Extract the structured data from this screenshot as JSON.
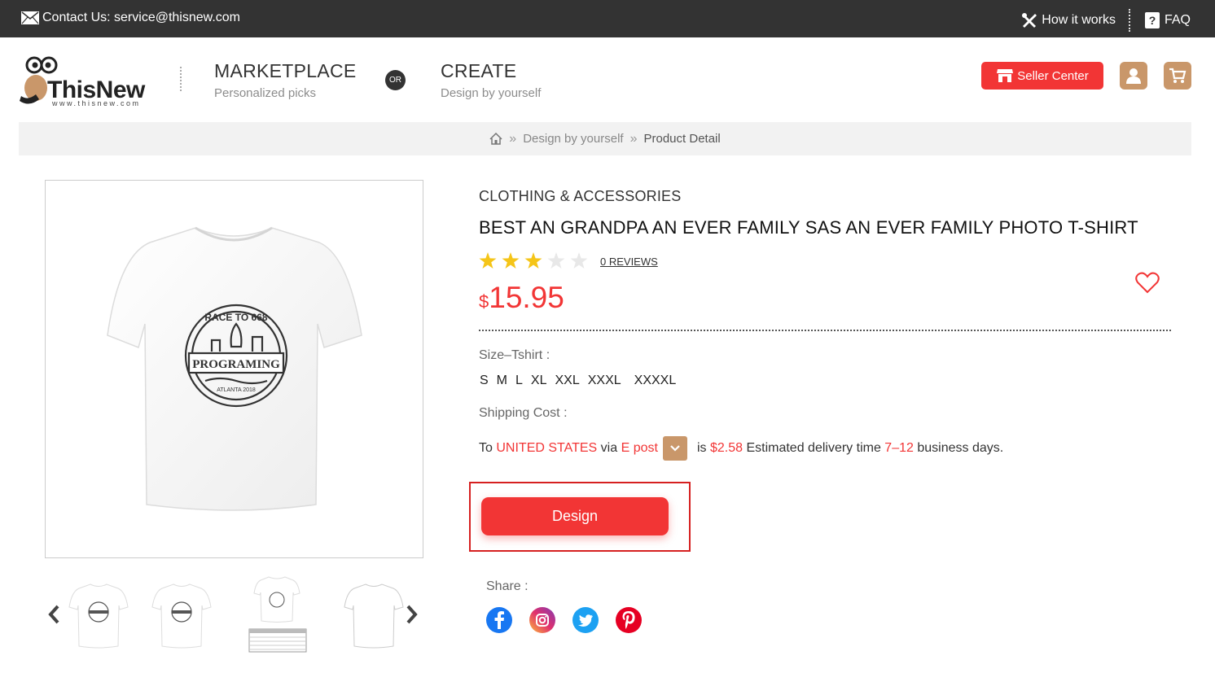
{
  "topbar": {
    "contact": "Contact Us: service@thisnew.com",
    "how_it_works": "How it works",
    "faq": "FAQ"
  },
  "header": {
    "logo_text": "ThisNew",
    "logo_url": "www.thisnew.com",
    "marketplace_title": "MARKETPLACE",
    "marketplace_sub": "Personalized picks",
    "or": "OR",
    "create_title": "CREATE",
    "create_sub": "Design by yourself",
    "seller_center": "Seller Center"
  },
  "breadcrumb": {
    "home_icon": "home-icon",
    "items": [
      "Design by yourself",
      "Product Detail"
    ]
  },
  "product": {
    "category": "CLOTHING & ACCESSORIES",
    "title": "BEST AN GRANDPA AN EVER FAMILY SAS  AN EVER FAMILY PHOTO T-SHIRT",
    "rating": 3,
    "rating_max": 5,
    "reviews": "0 REVIEWS",
    "currency": "$",
    "price": "15.95",
    "print_text_top": "RACE TO 668",
    "print_text_main": "PROGRAMING",
    "print_text_bottom": "ATLANTA 2018"
  },
  "options": {
    "size_label": "Size–Tshirt :",
    "sizes": [
      "S",
      "M",
      "L",
      "XL",
      "XXL",
      "XXXL",
      "XXXXL"
    ]
  },
  "shipping": {
    "label": "Shipping Cost :",
    "to": "To",
    "country": "UNITED STATES",
    "via": "via",
    "carrier": "E post",
    "is": "is",
    "cost": "$2.58",
    "estimated": "Estimated delivery time",
    "days": "7–12",
    "business_days": "business days."
  },
  "actions": {
    "design": "Design"
  },
  "share": {
    "label": "Share :",
    "networks": [
      "facebook-icon",
      "instagram-icon",
      "twitter-icon",
      "pinterest-icon"
    ]
  },
  "colors": {
    "accent_red": "#f23535",
    "topbar_bg": "#333333",
    "tan": "#c9976a",
    "star": "#f5c518"
  }
}
